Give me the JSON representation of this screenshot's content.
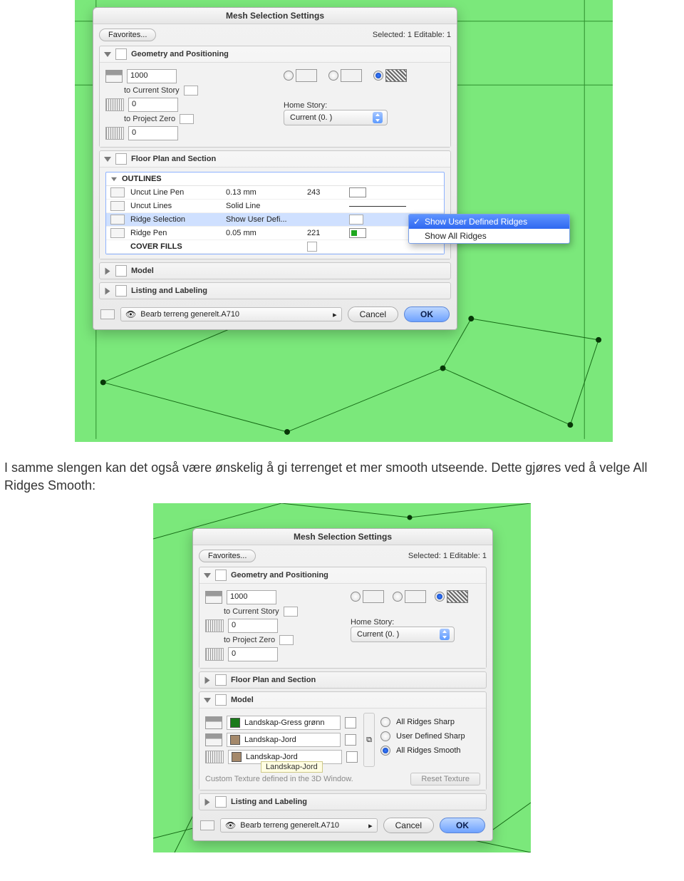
{
  "paragraph": "I samme slengen kan det også være ønskelig å gi terrenget et mer smooth utseende. Dette gjøres ved å velge All Ridges Smooth:",
  "dialog1": {
    "title": "Mesh Selection Settings",
    "favorites": "Favorites...",
    "status": "Selected: 1 Editable: 1",
    "geom": {
      "title": "Geometry and Positioning",
      "v1": "1000",
      "l1": "to Current Story",
      "v2": "0",
      "l2": "to Project Zero",
      "v3": "0",
      "home": "Home Story:",
      "homeval": "Current (0. )"
    },
    "fps": {
      "title": "Floor Plan and Section",
      "outlines": "OUTLINES",
      "rows": [
        {
          "name": "Uncut Line Pen",
          "v1": "0.13 mm",
          "v2": "243"
        },
        {
          "name": "Uncut Lines",
          "v1": "Solid Line",
          "v2": ""
        },
        {
          "name": "Ridge Selection",
          "v1": "Show User Defi...",
          "v2": ""
        },
        {
          "name": "Ridge Pen",
          "v1": "0.05 mm",
          "v2": "221"
        }
      ],
      "cover": "COVER FILLS"
    },
    "dropdown": {
      "opt1": "Show User Defined Ridges",
      "opt2": "Show All Ridges"
    },
    "model": "Model",
    "listing": "Listing and Labeling",
    "layer": "Bearb terreng generelt.A710",
    "cancel": "Cancel",
    "ok": "OK"
  },
  "dialog2": {
    "title": "Mesh Selection Settings",
    "favorites": "Favorites...",
    "status": "Selected: 1 Editable: 1",
    "geom": {
      "title": "Geometry and Positioning",
      "v1": "1000",
      "l1": "to Current Story",
      "v2": "0",
      "l2": "to Project Zero",
      "v3": "0",
      "home": "Home Story:",
      "homeval": "Current (0. )"
    },
    "fps": "Floor Plan and Section",
    "model": {
      "title": "Model",
      "mats": [
        {
          "name": "Landskap-Gress grønn"
        },
        {
          "name": "Landskap-Jord"
        },
        {
          "name": "Landskap-Jord"
        }
      ],
      "tooltip": "Landskap-Jord",
      "custom": "Custom Texture defined in the 3D Window.",
      "r1": "All Ridges Sharp",
      "r2": "User Defined Sharp",
      "r3": "All Ridges Smooth",
      "reset": "Reset Texture"
    },
    "listing": "Listing and Labeling",
    "layer": "Bearb terreng generelt.A710",
    "cancel": "Cancel",
    "ok": "OK"
  }
}
